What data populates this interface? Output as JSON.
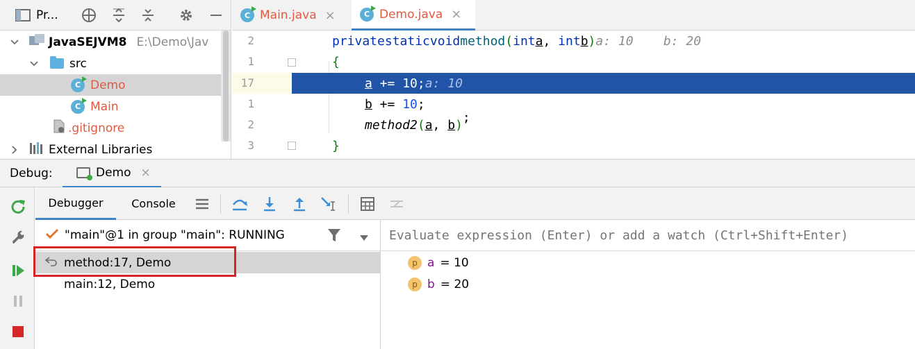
{
  "project": {
    "title": "Pr...",
    "tree": [
      {
        "label": "JavaSEJVM8",
        "path": "E:\\Demo\\Jav"
      },
      {
        "label": "src"
      },
      {
        "label": "Demo"
      },
      {
        "label": "Main"
      },
      {
        "label": ".gitignore"
      },
      {
        "label": "External Libraries"
      }
    ]
  },
  "editor": {
    "tabs": [
      {
        "label": "Main.java",
        "close": "×"
      },
      {
        "label": "Demo.java",
        "close": "×"
      }
    ],
    "gutter": [
      "2",
      "1",
      "17",
      "1",
      "2",
      "3"
    ],
    "code": {
      "l1_kw1": "private",
      "l1_kw2": "static",
      "l1_kw3": "void",
      "l1_name": "method",
      "l1_p1t": "int",
      "l1_p1": "a",
      "l1_p2t": "int",
      "l1_p2": "b",
      "l1_hint": "a: 10    b: 20",
      "l2": "{",
      "l3_var": "a",
      "l3_op": " += ",
      "l3_num": "10",
      "l3_end": ";",
      "l3_hint": "a: 10",
      "l4_var": "b",
      "l4_op": " += ",
      "l4_num": "10",
      "l4_end": ";",
      "l5_fn": "method2",
      "l5_a": "a",
      "l5_b": "b",
      "l6": "}"
    }
  },
  "debug": {
    "label": "Debug:",
    "run_tab": "Demo",
    "run_tab_close": "×",
    "tabs": [
      "Debugger",
      "Console"
    ],
    "thread": "\"main\"@1 in group \"main\": RUNNING",
    "frames": [
      "method:17, Demo",
      "main:12, Demo"
    ],
    "eval_placeholder": "Evaluate expression (Enter) or add a watch (Ctrl+Shift+Enter)",
    "variables": [
      {
        "badge": "p",
        "name": "a",
        "value": "= 10"
      },
      {
        "badge": "p",
        "name": "b",
        "value": "= 20"
      }
    ]
  },
  "colors": {
    "accent": "#4083c9",
    "execution_line": "#2154a6",
    "class_name": "#e05a41",
    "highlight_box": "#d72626"
  }
}
